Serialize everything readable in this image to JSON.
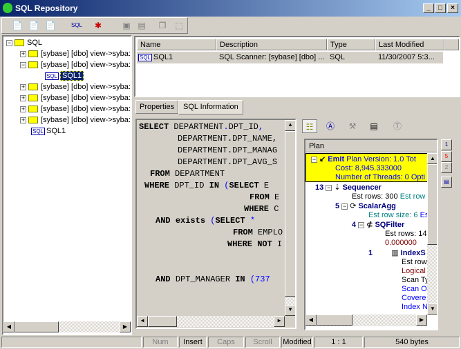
{
  "window": {
    "title": "SQL Repository",
    "minimize": "_",
    "maximize": "□",
    "close": "×"
  },
  "toolbar": {
    "icons": [
      "import-icon",
      "import-red-icon",
      "import-key-icon",
      "sql-scanner-icon",
      "plan-compare-icon",
      "save-icon",
      "print-icon",
      "copy-icon",
      "select-all-icon"
    ]
  },
  "tree": {
    "root": "SQL",
    "items": [
      {
        "label": "[sybase] [dbo] view->syba:",
        "expanded": false
      },
      {
        "label": "[sybase] [dbo] view->syba:",
        "expanded": true,
        "child": "SQL1"
      },
      {
        "label": "[sybase] [dbo] view->syba:",
        "expanded": false
      },
      {
        "label": "[sybase] [dbo] view->syba:",
        "expanded": false
      },
      {
        "label": "[sybase] [dbo] view->syba:",
        "expanded": false
      },
      {
        "label": "[sybase] [dbo] view->syba:",
        "expanded": false
      }
    ],
    "leaf": "SQL1"
  },
  "list": {
    "columns": [
      "Name",
      "Description",
      "Type",
      "Last Modified"
    ],
    "rows": [
      {
        "name": "SQL1",
        "description": "SQL Scanner: [sybase] [dbo] ...",
        "type": "SQL",
        "modified": "11/30/2007 5:3..."
      }
    ]
  },
  "tabs": [
    "Properties",
    "SQL Information"
  ],
  "sql": {
    "l1a": "SELECT",
    "l1b": " DEPARTMENT",
    "l1c": ".",
    "l1d": "DPT_ID",
    "l1e": ",",
    "l2": "DEPARTMENT.DPT_NAME,",
    "l3": "DEPARTMENT.DPT_MANAG",
    "l4": "DEPARTMENT.DPT_AVG_S",
    "from": "FROM",
    "dept": "DEPARTMENT",
    "where": "WHERE",
    "dptid": "DPT_ID",
    "in": "IN",
    "paren": "(",
    "select": "SELECT",
    "e": "E",
    "from2": "FROM",
    "e2": "E",
    "where2": "WHERE",
    "c": "C",
    "and": "AND",
    "exists": "exists",
    "paren2": "(",
    "select2": "SELECT",
    "star": "*",
    "from3": "FROM",
    "emp": "EMPLO",
    "where3": "WHERE",
    "not": "NOT",
    "bar": "I",
    "and2": "AND",
    "mgr": "DPT_MANAGER",
    "in2": "IN",
    "nums": "(737"
  },
  "plan": {
    "header": "Plan",
    "emit": {
      "name": "Emit",
      "info": "Plan Version: 1.0  Tot",
      "cost": "Cost: 8,945.333000",
      "threads": "Number of Threads: 0  Opti"
    },
    "seq": {
      "num": "13",
      "name": "Sequencer",
      "rows": "Est rows: 300",
      "extra": "Est row"
    },
    "agg": {
      "num": "5",
      "name": "ScalarAgg",
      "size": "Est row size: 6",
      "extra": "Es"
    },
    "filter": {
      "num": "4",
      "name": "SQFilter",
      "rows": "Est rows: 14",
      "cost": "0.000000"
    },
    "index": {
      "num": "1",
      "name": "IndexS",
      "l1": "Est row",
      "l2": "Logical I",
      "l3": "Scan Ty",
      "l4": "Scan Or",
      "l5": "Covere",
      "l6": "Index N"
    },
    "side_buttons": [
      "1",
      "5",
      "2"
    ]
  },
  "status": {
    "num": "Num",
    "insert": "Insert",
    "caps": "Caps",
    "scroll": "Scroll",
    "modified": "Modified",
    "pos": "1 : 1",
    "size": "540 bytes"
  }
}
